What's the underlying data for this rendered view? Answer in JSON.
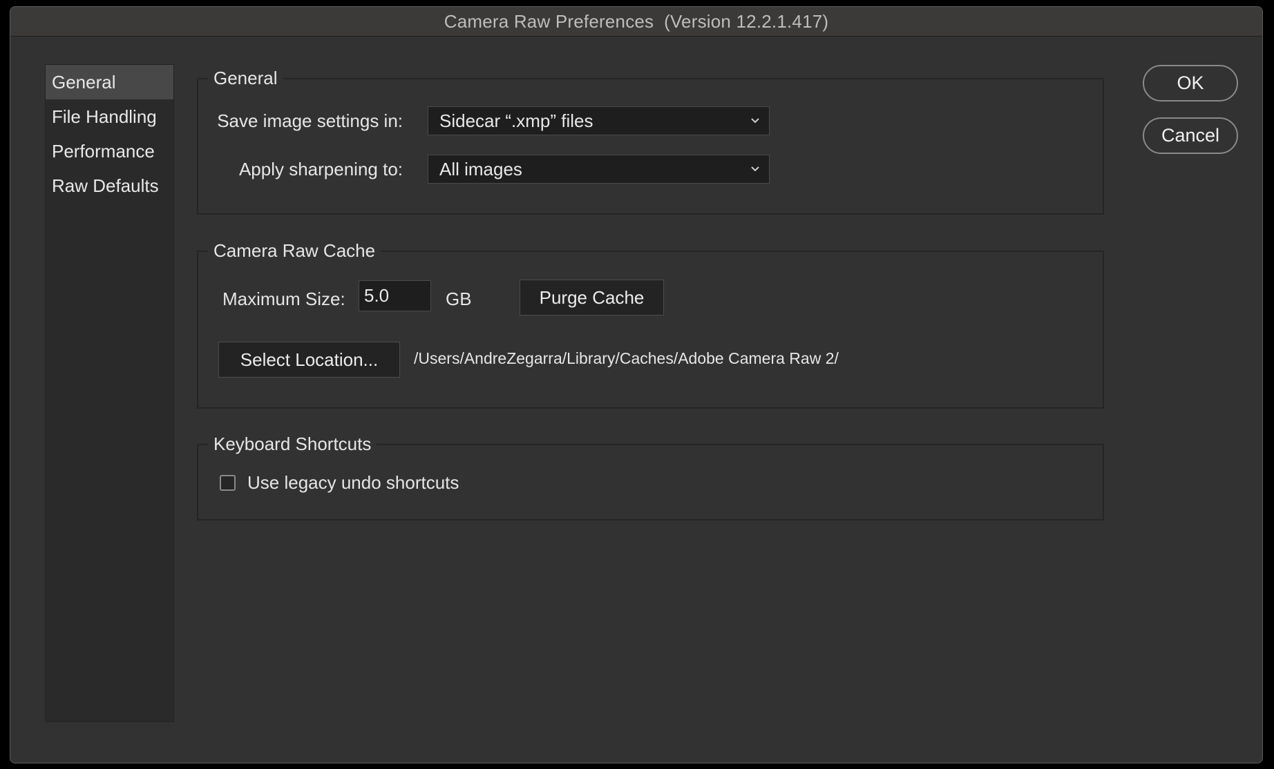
{
  "window": {
    "title": "Camera Raw Preferences  (Version 12.2.1.417)"
  },
  "sidebar": {
    "items": [
      {
        "label": "General",
        "selected": true
      },
      {
        "label": "File Handling",
        "selected": false
      },
      {
        "label": "Performance",
        "selected": false
      },
      {
        "label": "Raw Defaults",
        "selected": false
      }
    ]
  },
  "general": {
    "title": "General",
    "save_settings_label": "Save image settings in:",
    "save_settings_value": "Sidecar “.xmp” files",
    "sharpening_label": "Apply sharpening to:",
    "sharpening_value": "All images"
  },
  "cache": {
    "title": "Camera Raw Cache",
    "max_size_label": "Maximum Size:",
    "max_size_value": "5.0",
    "unit": "GB",
    "purge_label": "Purge Cache",
    "select_location_label": "Select Location...",
    "path": "/Users/AndreZegarra/Library/Caches/Adobe Camera Raw 2/"
  },
  "shortcuts": {
    "title": "Keyboard Shortcuts",
    "legacy_undo_label": "Use legacy undo shortcuts",
    "legacy_undo_checked": false
  },
  "buttons": {
    "ok": "OK",
    "cancel": "Cancel"
  },
  "colors": {
    "window_bg": "#323232",
    "titlebar_bg": "#3c3a39",
    "sidebar_bg": "#2a2a2a",
    "sidebar_selected": "#484848",
    "field_bg": "#1e1e1e"
  },
  "icons": {
    "dropdown": "chevron-down-icon"
  }
}
